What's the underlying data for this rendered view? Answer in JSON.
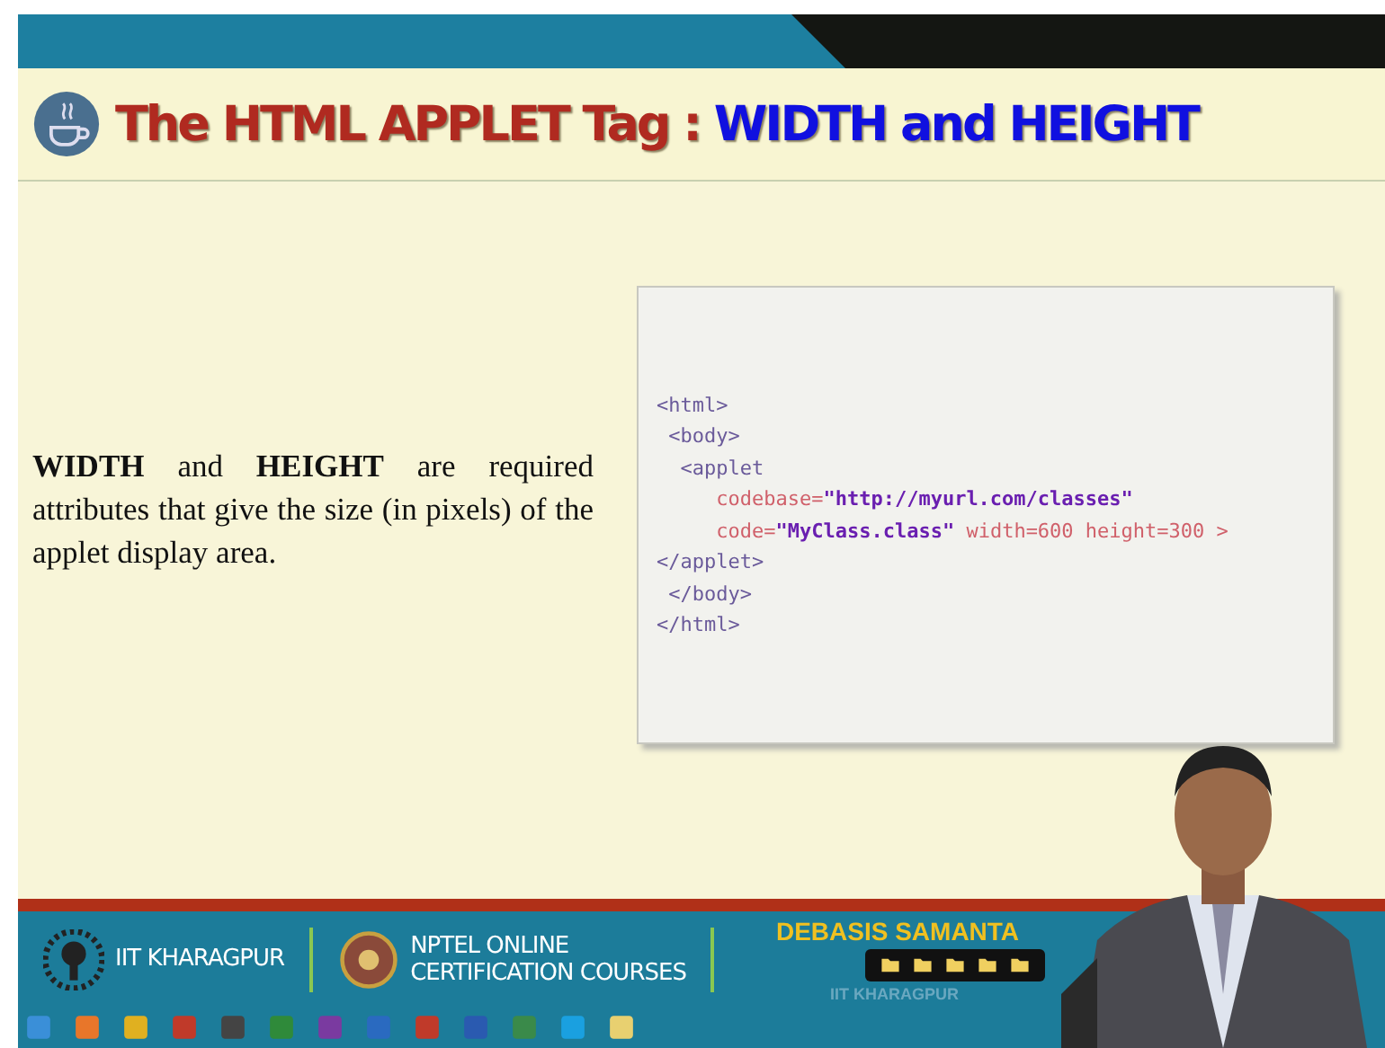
{
  "slide": {
    "title_parts": [
      {
        "text": "The HTML APPLET Tag :",
        "emphasis": false
      },
      {
        "text": "WIDTH and HEIGHT",
        "emphasis": true
      }
    ],
    "description": "**WIDTH** and **HEIGHT** are required attributes that give the size (in pixels) of the applet display area.",
    "code_lines": [
      [
        {
          "text": "<html>",
          "kind": "tag"
        }
      ],
      [
        {
          "text": " <body>",
          "kind": "tag"
        }
      ],
      [
        {
          "text": "  <applet",
          "kind": "tag"
        }
      ],
      [
        {
          "text": "     codebase=",
          "kind": "attr"
        },
        {
          "text": "\"http://myurl.com/classes\"",
          "kind": "string"
        }
      ],
      [
        {
          "text": "     code=",
          "kind": "attr"
        },
        {
          "text": "\"MyClass.class\"",
          "kind": "string"
        },
        {
          "text": " width=600 height=300 >",
          "kind": "attr"
        }
      ],
      [
        {
          "text": "</applet>",
          "kind": "tag"
        }
      ],
      [
        {
          "text": " </body>",
          "kind": "tag"
        }
      ],
      [
        {
          "text": "</html>",
          "kind": "tag"
        }
      ]
    ]
  },
  "footer": {
    "institute": "IIT KHARAGPUR",
    "course_line_1": "NPTEL ONLINE",
    "course_line_2": "CERTIFICATION COURSES",
    "presenter_name": "DEBASIS SAMANTA",
    "faded_caption": "IIT KHARAGPUR"
  }
}
